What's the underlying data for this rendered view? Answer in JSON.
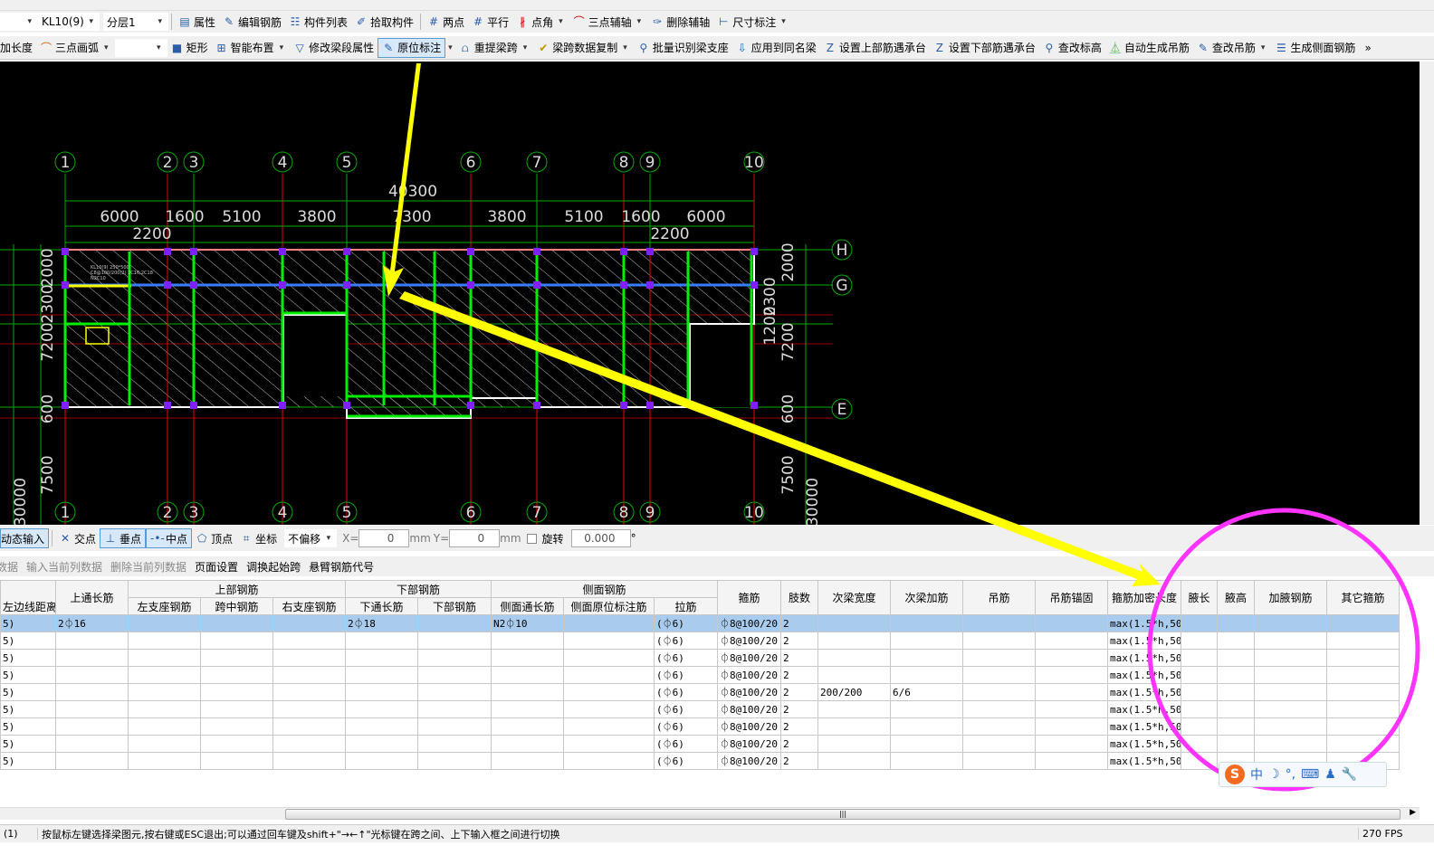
{
  "toolbar_top": {
    "component": "KL10(9)",
    "layer": "分层1",
    "items": [
      "属性",
      "编辑钢筋",
      "构件列表",
      "拾取构件",
      "两点",
      "平行",
      "点角",
      "三点辅轴",
      "删除辅轴",
      "尺寸标注"
    ]
  },
  "toolbar_second": {
    "items": [
      "加长度",
      "三点画弧",
      "矩形",
      "智能布置",
      "修改梁段属性",
      "原位标注",
      "重提梁跨",
      "梁跨数据复制",
      "批量识别梁支座",
      "应用到同名梁",
      "设置上部筋遇承台",
      "设置下部筋遇承台",
      "查改标高",
      "自动生成吊筋",
      "查改吊筋",
      "生成侧面钢筋"
    ],
    "more": "»"
  },
  "drawing": {
    "axes_x": [
      "1",
      "2",
      "3",
      "4",
      "5",
      "6",
      "7",
      "8",
      "9",
      "10"
    ],
    "axes_y": [
      "H",
      "G",
      "E"
    ],
    "total_dim": "40300",
    "span_dims": [
      "6000",
      "1600",
      "5100",
      "3800",
      "7300",
      "3800",
      "5100",
      "1600",
      "6000"
    ],
    "sub_dims": [
      "2200",
      "2200"
    ],
    "left_dims": [
      "2000",
      "2300",
      "7200",
      "600",
      "7500",
      "30000"
    ],
    "right_dims": [
      "2000",
      "2300",
      "1200",
      "7200",
      "600",
      "7500",
      "30000"
    ],
    "beam_label": [
      "KL10(9) 250*500",
      "C8@100/200(2) 2C16;2C18",
      "N2C10"
    ],
    "annotation_colors": {
      "arrow": "#ffff00",
      "circle": "#ff33ff"
    }
  },
  "snapbar": {
    "dynamic_input": "动态输入",
    "items": [
      "交点",
      "垂点",
      "中点",
      "顶点",
      "坐标"
    ],
    "offset": "不偏移",
    "x_label": "X=",
    "x_value": "0",
    "unit": "mm",
    "y_label": "Y=",
    "y_value": "0",
    "rotate_label": "旋转",
    "rotate_value": "0.000",
    "degree": "°"
  },
  "table_toolbar": [
    "数据",
    "输入当前列数据",
    "删除当前列数据",
    "页面设置",
    "调换起始跨",
    "悬臂钢筋代号"
  ],
  "table": {
    "group_headers": {
      "top": "上部钢筋",
      "bottom": "下部钢筋",
      "side": "侧面钢筋"
    },
    "columns": [
      "左边线距离",
      "上通长筋",
      "左支座钢筋",
      "跨中钢筋",
      "右支座钢筋",
      "下通长筋",
      "下部钢筋",
      "侧面通长筋",
      "侧面原位标注筋",
      "拉筋",
      "箍筋",
      "肢数",
      "次梁宽度",
      "次梁加筋",
      "吊筋",
      "吊筋锚固",
      "箍筋加密长度",
      "腋长",
      "腋高",
      "加腋钢筋",
      "其它箍筋"
    ],
    "rows": [
      [
        "5)",
        "2⏀16",
        "",
        "",
        "",
        "2⏀18",
        "",
        "N2⏀10",
        "",
        "(⏀6)",
        "⏀8@100/20",
        "2",
        "",
        "",
        "",
        "",
        "max(1.5*h,50",
        "",
        "",
        "",
        ""
      ],
      [
        "5)",
        "",
        "",
        "",
        "",
        "",
        "",
        "",
        "",
        "(⏀6)",
        "⏀8@100/20",
        "2",
        "",
        "",
        "",
        "",
        "max(1.5*h,50",
        "",
        "",
        "",
        ""
      ],
      [
        "5)",
        "",
        "",
        "",
        "",
        "",
        "",
        "",
        "",
        "(⏀6)",
        "⏀8@100/20",
        "2",
        "",
        "",
        "",
        "",
        "max(1.5*h,50",
        "",
        "",
        "",
        ""
      ],
      [
        "5)",
        "",
        "",
        "",
        "",
        "",
        "",
        "",
        "",
        "(⏀6)",
        "⏀8@100/20",
        "2",
        "",
        "",
        "",
        "",
        "max(1.5*h,50",
        "",
        "",
        "",
        ""
      ],
      [
        "5)",
        "",
        "",
        "",
        "",
        "",
        "",
        "",
        "",
        "(⏀6)",
        "⏀8@100/20",
        "2",
        "200/200",
        "6/6",
        "",
        "",
        "max(1.5*h,50",
        "",
        "",
        "",
        ""
      ],
      [
        "5)",
        "",
        "",
        "",
        "",
        "",
        "",
        "",
        "",
        "(⏀6)",
        "⏀8@100/20",
        "2",
        "",
        "",
        "",
        "",
        "max(1.5*h,50",
        "",
        "",
        "",
        ""
      ],
      [
        "5)",
        "",
        "",
        "",
        "",
        "",
        "",
        "",
        "",
        "(⏀6)",
        "⏀8@100/20",
        "2",
        "",
        "",
        "",
        "",
        "max(1.5*h,50",
        "",
        "",
        "",
        ""
      ],
      [
        "5)",
        "",
        "",
        "",
        "",
        "",
        "",
        "",
        "",
        "(⏀6)",
        "⏀8@100/20",
        "2",
        "",
        "",
        "",
        "",
        "max(1.5*h,50",
        "",
        "",
        "",
        ""
      ],
      [
        "5)",
        "",
        "",
        "",
        "",
        "",
        "",
        "",
        "",
        "(⏀6)",
        "⏀8@100/20",
        "2",
        "",
        "",
        "",
        "",
        "max(1.5*h,50",
        "",
        "",
        "",
        ""
      ]
    ]
  },
  "ime": {
    "items": [
      "S",
      "中",
      "☽",
      "°,",
      "⌨",
      "♟",
      "🔧"
    ]
  },
  "status": {
    "left": "(1)",
    "message": "按鼠标左键选择梁图元,按右键或ESC退出;可以通过回车键及shift+\"→←↑\"光标键在跨之间、上下输入框之间进行切换",
    "fps": "270 FPS"
  }
}
